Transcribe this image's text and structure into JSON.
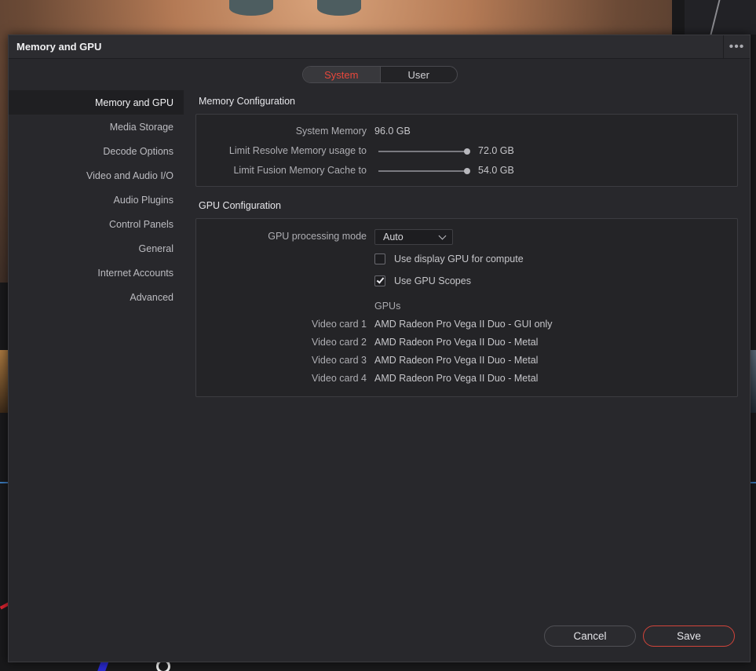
{
  "dialog": {
    "title": "Memory and GPU",
    "more_icon": "more-horizontal-icon",
    "more_glyph": "•••"
  },
  "tabs": [
    {
      "label": "System",
      "active": true
    },
    {
      "label": "User",
      "active": false
    }
  ],
  "sidebar": {
    "items": [
      {
        "label": "Memory and GPU",
        "active": true
      },
      {
        "label": "Media Storage"
      },
      {
        "label": "Decode Options"
      },
      {
        "label": "Video and Audio I/O"
      },
      {
        "label": "Audio Plugins"
      },
      {
        "label": "Control Panels"
      },
      {
        "label": "General"
      },
      {
        "label": "Internet Accounts"
      },
      {
        "label": "Advanced"
      }
    ]
  },
  "memory": {
    "title": "Memory Configuration",
    "system_memory_label": "System Memory",
    "system_memory_value": "96.0 GB",
    "resolve_label": "Limit Resolve Memory usage to",
    "resolve_value": "72.0 GB",
    "resolve_fraction": 1.0,
    "fusion_label": "Limit Fusion Memory Cache to",
    "fusion_value": "54.0 GB",
    "fusion_fraction": 1.0
  },
  "gpu": {
    "title": "GPU Configuration",
    "mode_label": "GPU processing mode",
    "mode_value": "Auto",
    "display_gpu_label": "Use display GPU for compute",
    "display_gpu_checked": false,
    "scopes_label": "Use GPU Scopes",
    "scopes_checked": true,
    "gpus_heading": "GPUs",
    "cards": [
      {
        "label": "Video card 1",
        "value": "AMD Radeon Pro Vega II Duo - GUI only"
      },
      {
        "label": "Video card 2",
        "value": "AMD Radeon Pro Vega II Duo - Metal"
      },
      {
        "label": "Video card 3",
        "value": "AMD Radeon Pro Vega II Duo - Metal"
      },
      {
        "label": "Video card 4",
        "value": "AMD Radeon Pro Vega II Duo - Metal"
      }
    ]
  },
  "footer": {
    "cancel_label": "Cancel",
    "save_label": "Save"
  },
  "colors": {
    "accent": "#e8473b",
    "dialog_bg": "#28282c",
    "panel_bg": "#242427"
  }
}
